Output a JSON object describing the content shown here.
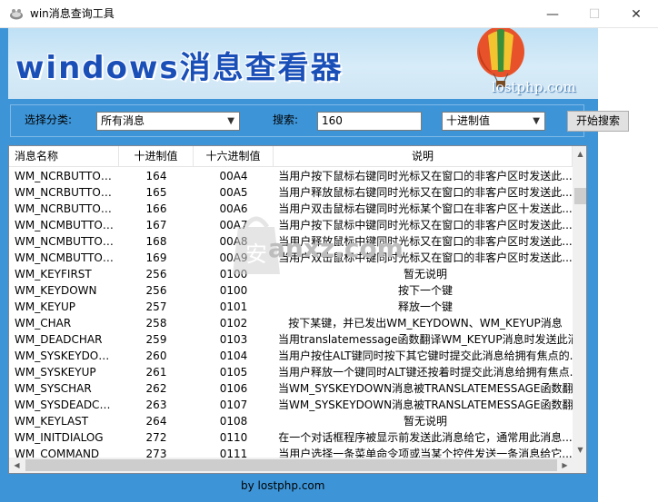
{
  "window": {
    "title": "win消息查询工具",
    "controls": {
      "minimize": "—",
      "maximize": "☐",
      "close": "✕"
    }
  },
  "banner": {
    "title": "windows消息查看器",
    "url": "lostphp.com"
  },
  "filters": {
    "category_label": "选择分类:",
    "category_value": "所有消息",
    "search_label": "搜索:",
    "search_value": "160",
    "base_value": "十进制值",
    "search_button": "开始搜索"
  },
  "table": {
    "columns": [
      "消息名称",
      "十进制值",
      "十六进制值",
      "说明"
    ],
    "rows": [
      [
        "WM_NCRBUTTON...",
        "164",
        "00A4",
        "当用户按下鼠标右键同时光标又在窗口的非客户区时发送此..."
      ],
      [
        "WM_NCRBUTTON...",
        "165",
        "00A5",
        "当用户释放鼠标右键同时光标又在窗口的非客户区时发送此..."
      ],
      [
        "WM_NCRBUTTON...",
        "166",
        "00A6",
        "当用户双击鼠标右键同时光标某个窗口在非客户区十发送此..."
      ],
      [
        "WM_NCMBUTTON...",
        "167",
        "00A7",
        "当用户按下鼠标中键同时光标又在窗口的非客户区时发送此..."
      ],
      [
        "WM_NCMBUTTON...",
        "168",
        "00A8",
        "当用户释放鼠标中键同时光标又在窗口的非客户区时发送此..."
      ],
      [
        "WM_NCMBUTTON...",
        "169",
        "00A9",
        "当用户双击鼠标中键同时光标又在窗口的非客户区时发送此..."
      ],
      [
        "WM_KEYFIRST",
        "256",
        "0100",
        "暂无说明"
      ],
      [
        "WM_KEYDOWN",
        "256",
        "0100",
        "按下一个键"
      ],
      [
        "WM_KEYUP",
        "257",
        "0101",
        "释放一个键"
      ],
      [
        "WM_CHAR",
        "258",
        "0102",
        "按下某键，并已发出WM_KEYDOWN、WM_KEYUP消息"
      ],
      [
        "WM_DEADCHAR",
        "259",
        "0103",
        "当用translatemessage函数翻译WM_KEYUP消息时发送此消..."
      ],
      [
        "WM_SYSKEYDOWN",
        "260",
        "0104",
        "当用户按住ALT键同时按下其它键时提交此消息给拥有焦点的..."
      ],
      [
        "WM_SYSKEYUP",
        "261",
        "0105",
        "当用户释放一个键同时ALT键还按着时提交此消息给拥有焦点..."
      ],
      [
        "WM_SYSCHAR",
        "262",
        "0106",
        "当WM_SYSKEYDOWN消息被TRANSLATEMESSAGE函数翻..."
      ],
      [
        "WM_SYSDEADCHAR",
        "263",
        "0107",
        "当WM_SYSKEYDOWN消息被TRANSLATEMESSAGE函数翻..."
      ],
      [
        "WM_KEYLAST",
        "264",
        "0108",
        "暂无说明"
      ],
      [
        "WM_INITDIALOG",
        "272",
        "0110",
        "在一个对话框程序被显示前发送此消息给它，通常用此消息..."
      ],
      [
        "WM_COMMAND",
        "273",
        "0111",
        "当用户选择一条菜单命令项或当某个控件发送一条消息给它..."
      ]
    ]
  },
  "footer": {
    "text": "by lostphp.com"
  },
  "watermark": {
    "text": "anxz.com",
    "glyph": "安"
  },
  "colors": {
    "app_bg": "#3d95d8",
    "banner_title": "#1a4fb8"
  }
}
